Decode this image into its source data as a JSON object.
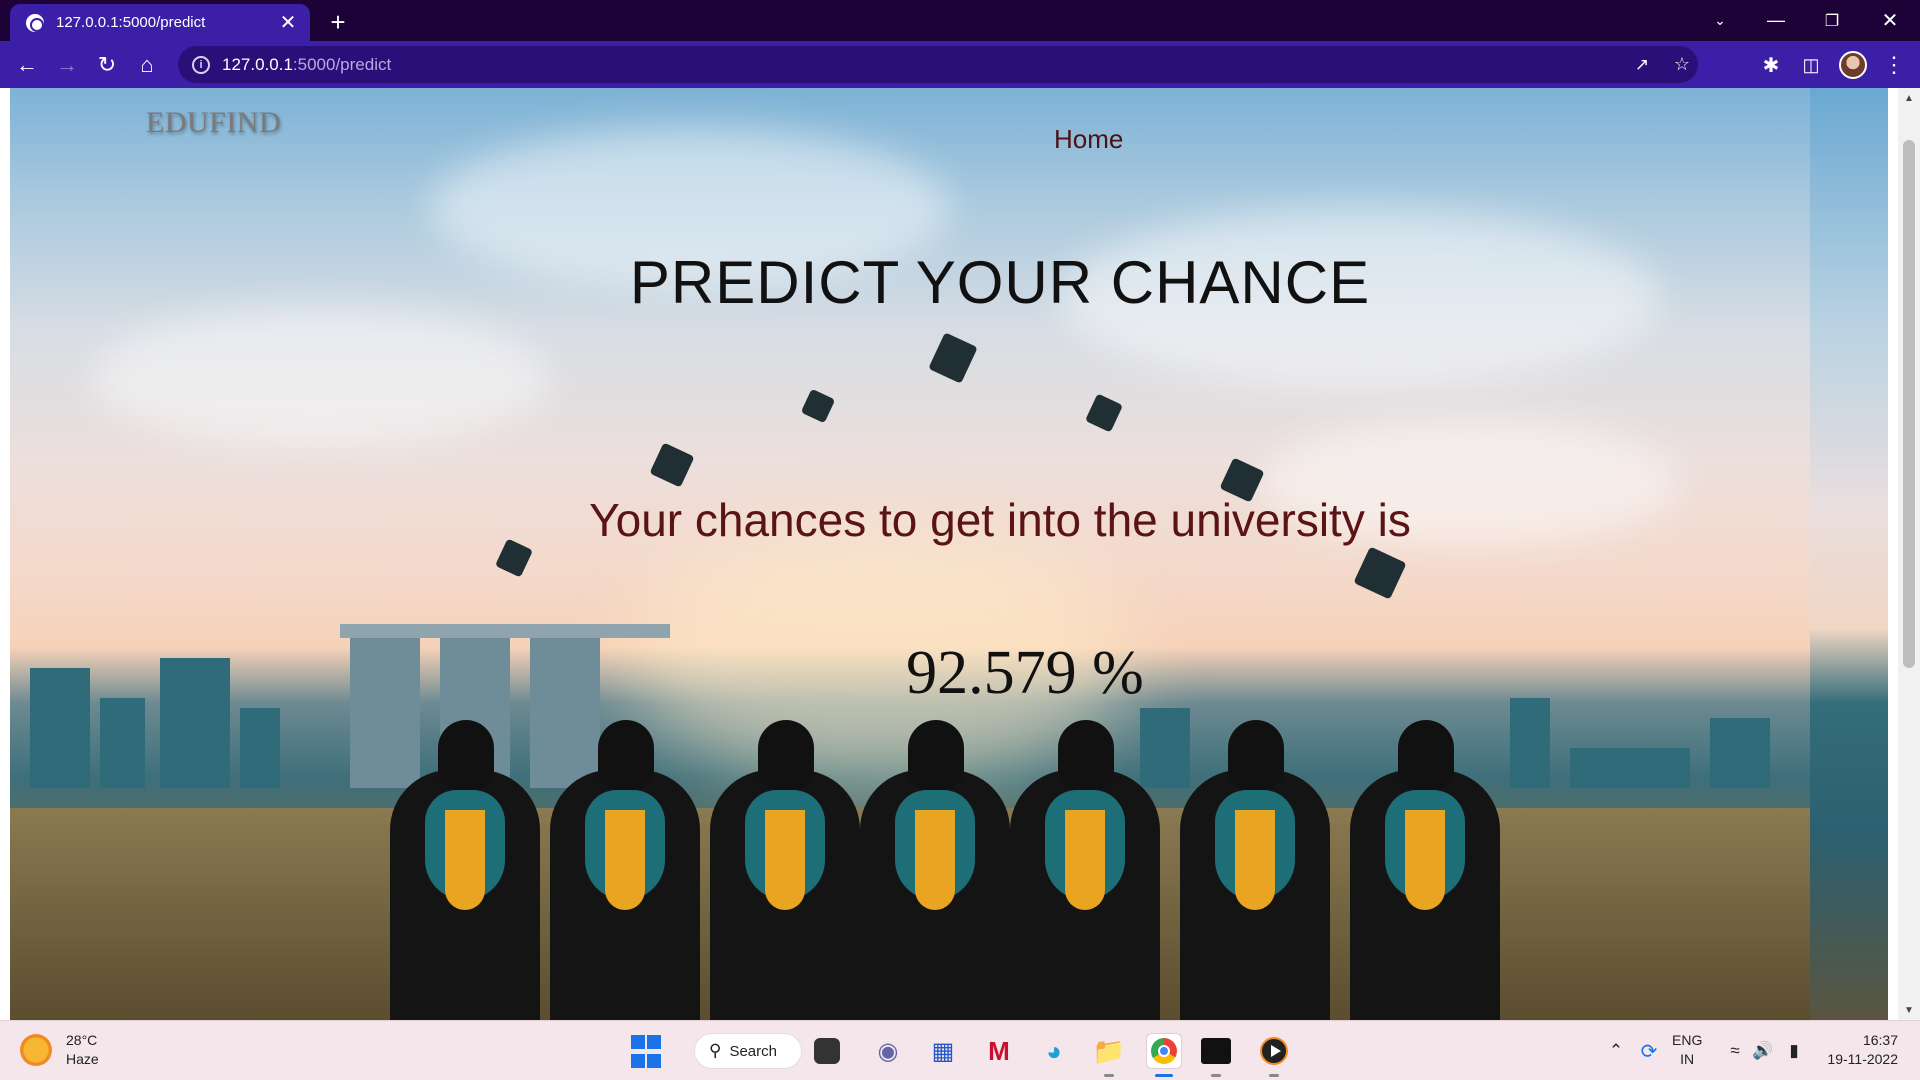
{
  "browser": {
    "tab_title": "127.0.0.1:5000/predict",
    "tab_close": "✕",
    "new_tab": "+",
    "url_host": "127.0.0.1",
    "url_path": ":5000/predict"
  },
  "page": {
    "brand": "EDUFIND",
    "nav_home": "Home",
    "title": "PREDICT YOUR CHANCE",
    "result_text": "Your chances to get into the university is",
    "result_value": "92.579 %"
  },
  "taskbar": {
    "weather_temp": "28°C",
    "weather_desc": "Haze",
    "search_label": "Search",
    "lang_primary": "ENG",
    "lang_secondary": "IN",
    "time": "16:37",
    "date": "19-11-2022"
  },
  "colors": {
    "browser_accent": "#3b1fa6",
    "title_bar": "#1c0236",
    "nav_home": "#4a1212",
    "result_text": "#5a1414"
  }
}
